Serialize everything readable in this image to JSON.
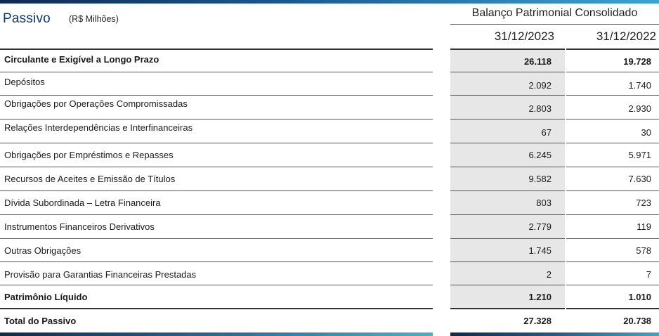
{
  "header": {
    "title": "Passivo",
    "subtitle": "(R$ Milhões)",
    "group": "Balanço Patrimonial Consolidado",
    "col_2023": "31/12/2023",
    "col_2022": "31/12/2022"
  },
  "rows": [
    {
      "label": "Circulante e Exigível a Longo Prazo",
      "v2023": "26.118",
      "v2022": "19.728",
      "bold": true
    },
    {
      "label": "Depósitos",
      "v2023": "2.092",
      "v2022": "1.740",
      "bold": false
    },
    {
      "label": "Obrigações por Operações Compromissadas",
      "v2023": "2.803",
      "v2022": "2.930",
      "bold": false
    },
    {
      "label": "Relações Interdependências e Interfinanceiras",
      "v2023": "67",
      "v2022": "30",
      "bold": false
    },
    {
      "label": "Obrigações por Empréstimos e Repasses",
      "v2023": "6.245",
      "v2022": "5.971",
      "bold": false
    },
    {
      "label": "Recursos de Aceites e Emissão de Títulos",
      "v2023": "9.582",
      "v2022": "7.630",
      "bold": false
    },
    {
      "label": "Dívida Subordinada – Letra Financeira",
      "v2023": "803",
      "v2022": "723",
      "bold": false
    },
    {
      "label": "Instrumentos Financeiros Derivativos",
      "v2023": "2.779",
      "v2022": "119",
      "bold": false
    },
    {
      "label": "Outras Obrigações",
      "v2023": "1.745",
      "v2022": "578",
      "bold": false
    },
    {
      "label": "Provisão para Garantias Financeiras Prestadas",
      "v2023": "2",
      "v2022": "7",
      "bold": false
    },
    {
      "label": "Patrimônio Líquido",
      "v2023": "1.210",
      "v2022": "1.010",
      "bold": true
    },
    {
      "label": "Total do Passivo",
      "v2023": "27.328",
      "v2022": "20.738",
      "bold": true
    }
  ]
}
